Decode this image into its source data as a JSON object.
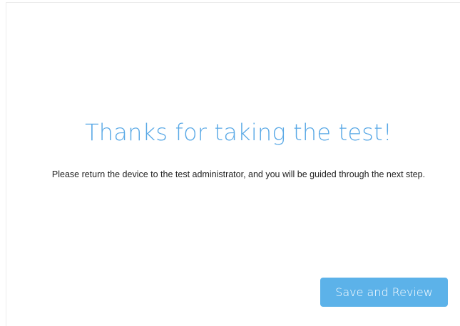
{
  "completion": {
    "title": "Thanks for taking the test!",
    "message": "Please return the device to the test administrator, and you will be guided through the next step."
  },
  "actions": {
    "save_review_label": "Save and Review"
  },
  "colors": {
    "accent": "#5aa9e6",
    "button_bg": "#5cb2e9",
    "text": "#222222"
  }
}
